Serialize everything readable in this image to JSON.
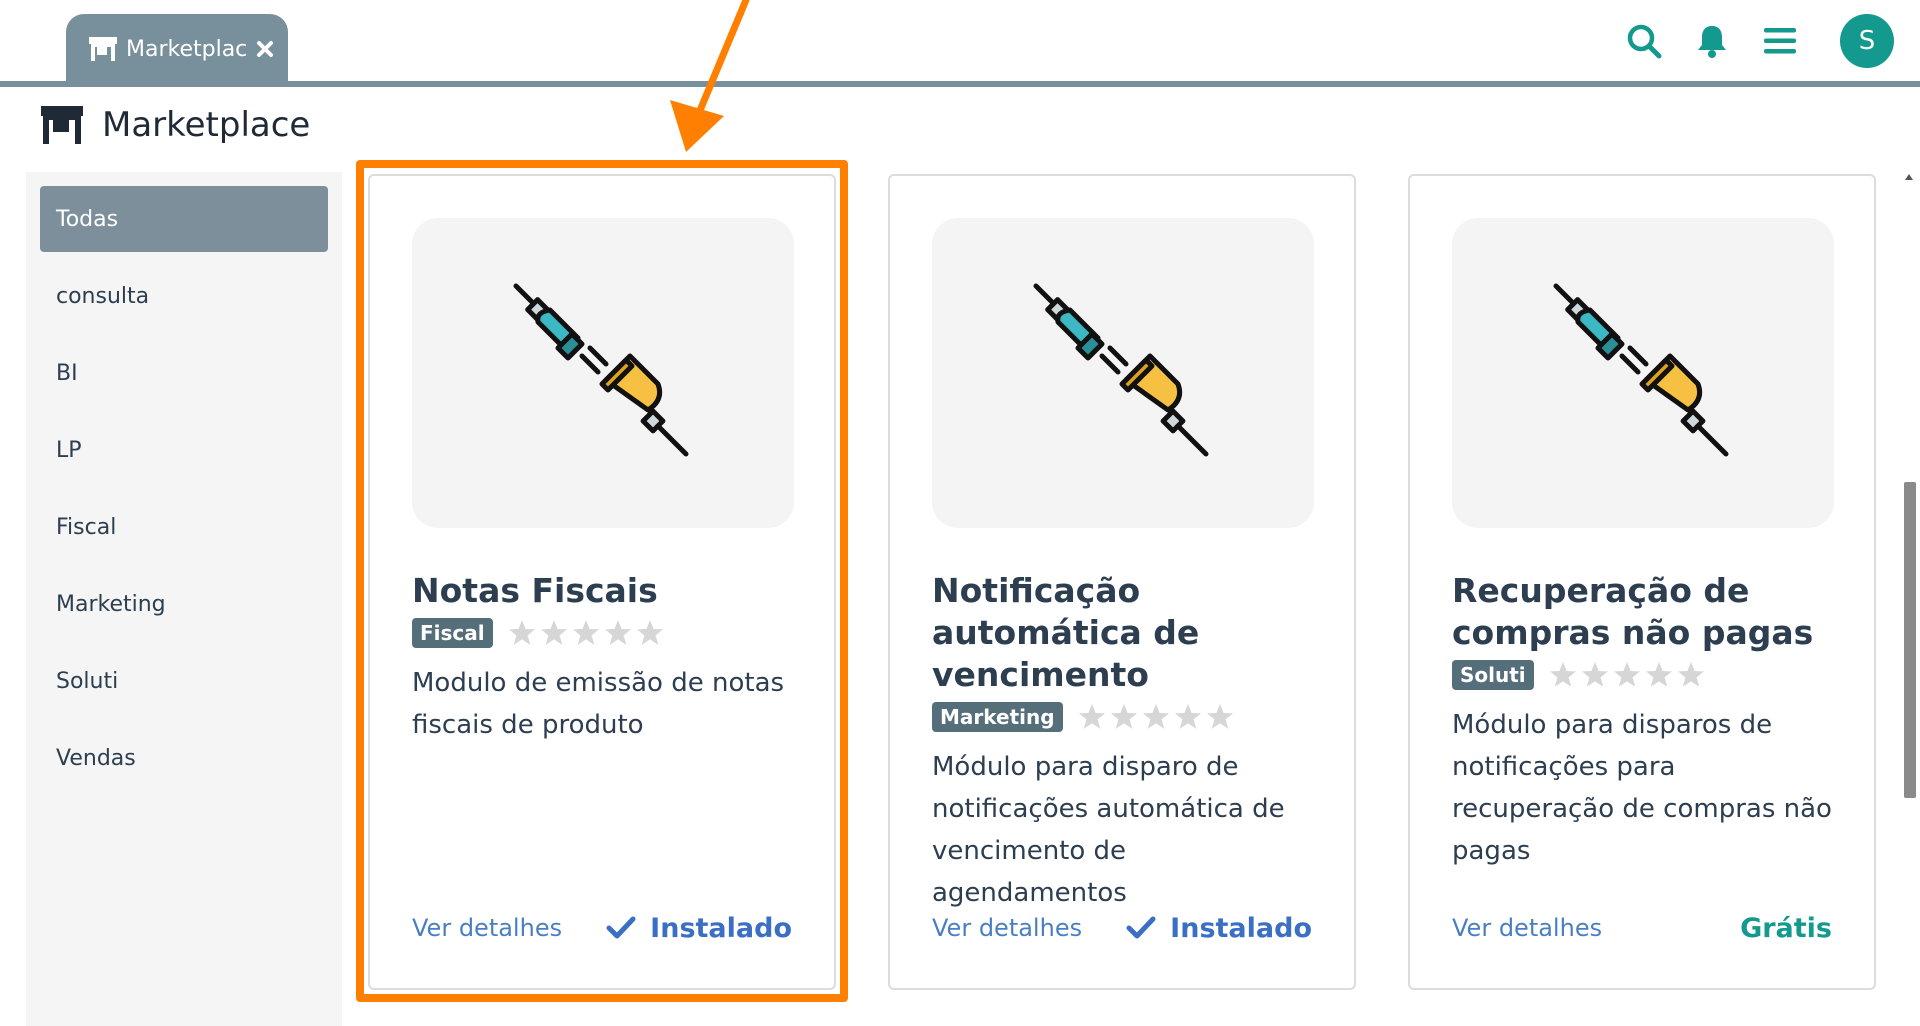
{
  "tab": {
    "label": "Marketplace"
  },
  "header": {
    "title": "Marketplace"
  },
  "user": {
    "initial": "S"
  },
  "sidebar": {
    "items": [
      {
        "label": "Todas",
        "active": true
      },
      {
        "label": "consulta"
      },
      {
        "label": "BI"
      },
      {
        "label": "LP"
      },
      {
        "label": "Fiscal"
      },
      {
        "label": "Marketing"
      },
      {
        "label": "Soluti"
      },
      {
        "label": "Vendas"
      }
    ]
  },
  "cards": [
    {
      "title": "Notas Fiscais",
      "tag": "Fiscal",
      "rating": 0,
      "description": "Modulo de emissão de notas fiscais de produto",
      "details_label": "Ver detalhes",
      "status": "Instalado"
    },
    {
      "title": "Notificação automática de vencimento",
      "tag": "Marketing",
      "rating": 0,
      "description": "Módulo para disparo de notificações automática de vencimento de agendamentos",
      "details_label": "Ver detalhes",
      "status": "Instalado"
    },
    {
      "title": "Recuperação de compras não pagas",
      "tag": "Soluti",
      "rating": 0,
      "description": "Módulo para disparos de notificações para recuperação de compras não pagas",
      "details_label": "Ver detalhes",
      "status": "Grátis"
    }
  ],
  "colors": {
    "accent": "#78909c",
    "teal": "#13998e",
    "link": "#4a7fc1",
    "highlight": "#ff7f00"
  },
  "icons": [
    "store-icon",
    "close-icon",
    "search-icon",
    "bell-icon",
    "menu-icon",
    "plug-icon",
    "star-icon",
    "check-icon"
  ]
}
